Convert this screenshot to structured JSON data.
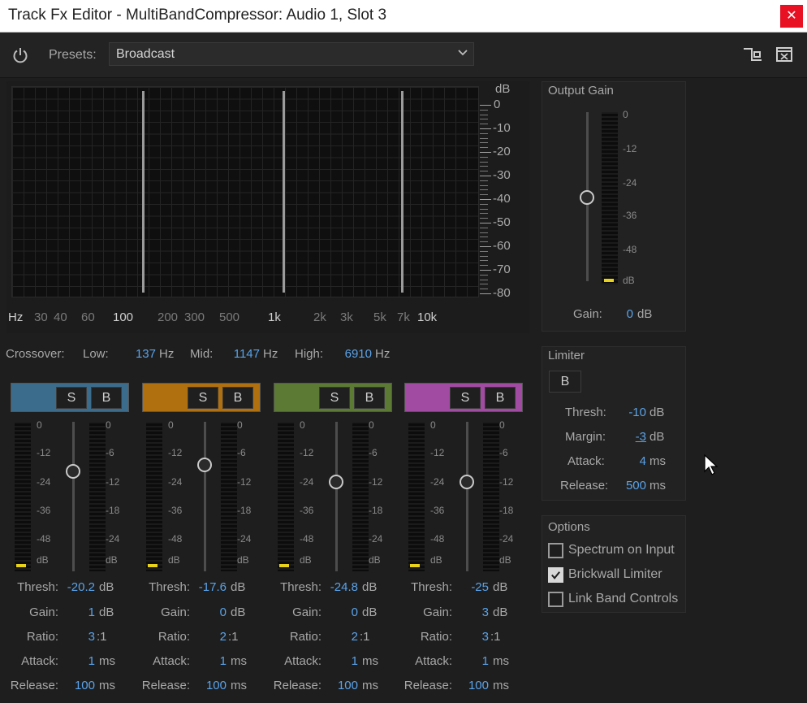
{
  "window": {
    "title": "Track Fx Editor - MultiBandCompressor: Audio 1, Slot 3",
    "close_glyph": "✕"
  },
  "toolbar": {
    "presets_label": "Presets:",
    "preset_value": "Broadcast"
  },
  "spectrum": {
    "db_unit": "dB",
    "db_ticks": [
      "0",
      "-10",
      "-20",
      "-30",
      "-40",
      "-50",
      "-60",
      "-70",
      "-80"
    ],
    "hz_unit": "Hz",
    "hz_ticks": [
      "30",
      "40",
      "60",
      "100",
      "200",
      "300",
      "500",
      "1k",
      "2k",
      "3k",
      "5k",
      "7k",
      "10k"
    ]
  },
  "crossover": {
    "label": "Crossover:",
    "low_label": "Low:",
    "low_value": "137",
    "low_unit": "Hz",
    "mid_label": "Mid:",
    "mid_value": "1147",
    "mid_unit": "Hz",
    "high_label": "High:",
    "high_value": "6910",
    "high_unit": "Hz"
  },
  "band_labels": {
    "solo": "S",
    "bypass": "B",
    "thresh": "Thresh:",
    "gain": "Gain:",
    "ratio": "Ratio:",
    "attack": "Attack:",
    "release": "Release:",
    "db": "dB",
    "ms": "ms",
    "ratio_suffix": ":1",
    "meter_left": [
      "0",
      "-12",
      "-24",
      "-36",
      "-48",
      "dB"
    ],
    "meter_right": [
      "0",
      "-6",
      "-12",
      "-18",
      "-24",
      "dB"
    ]
  },
  "bands": [
    {
      "color": "#3b6c8c",
      "thresh": "-20.2",
      "gain": "1",
      "ratio": "3",
      "attack": "1",
      "release": "100"
    },
    {
      "color": "#b07010",
      "thresh": "-17.6",
      "gain": "0",
      "ratio": "2",
      "attack": "1",
      "release": "100"
    },
    {
      "color": "#5c7a33",
      "thresh": "-24.8",
      "gain": "0",
      "ratio": "2",
      "attack": "1",
      "release": "100"
    },
    {
      "color": "#a24ba2",
      "thresh": "-25",
      "gain": "3",
      "ratio": "3",
      "attack": "1",
      "release": "100"
    }
  ],
  "output_gain": {
    "title": "Output Gain",
    "meter_labels": [
      "0",
      "-12",
      "-24",
      "-36",
      "-48",
      "dB"
    ],
    "gain_label": "Gain:",
    "gain_value": "0",
    "gain_unit": "dB"
  },
  "limiter": {
    "title": "Limiter",
    "bypass": "B",
    "thresh_label": "Thresh:",
    "thresh_value": "-10",
    "thresh_unit": "dB",
    "margin_label": "Margin:",
    "margin_value": "-3",
    "margin_unit": "dB",
    "attack_label": "Attack:",
    "attack_value": "4",
    "attack_unit": "ms",
    "release_label": "Release:",
    "release_value": "500",
    "release_unit": "ms"
  },
  "options": {
    "title": "Options",
    "items": [
      {
        "label": "Spectrum on Input",
        "checked": false
      },
      {
        "label": "Brickwall Limiter",
        "checked": true
      },
      {
        "label": "Link Band Controls",
        "checked": false
      }
    ]
  }
}
